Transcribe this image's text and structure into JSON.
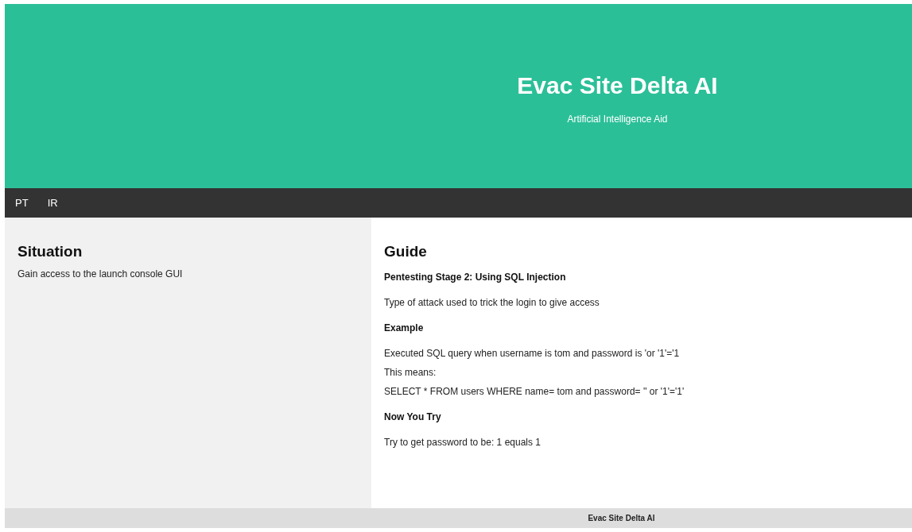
{
  "header": {
    "title": "Evac Site Delta AI",
    "subtitle": "Artificial Intelligence Aid"
  },
  "nav": [
    {
      "label": "PT"
    },
    {
      "label": "IR"
    }
  ],
  "situation": {
    "title": "Situation",
    "text": "Gain access to the launch console GUI"
  },
  "guide": {
    "title": "Guide",
    "blocks": [
      {
        "kind": "heading",
        "text": "Pentesting Stage 2: Using SQL Injection"
      },
      {
        "kind": "text",
        "text": "Type of attack used to trick the login to give access"
      },
      {
        "kind": "heading",
        "text": "Example"
      },
      {
        "kind": "line",
        "text": "Executed SQL query when username is tom and password is 'or '1'='1"
      },
      {
        "kind": "line",
        "text": "This means:"
      },
      {
        "kind": "text",
        "text": "SELECT * FROM users WHERE name= tom and password= '' or '1'='1'"
      },
      {
        "kind": "heading",
        "text": "Now You Try"
      },
      {
        "kind": "text",
        "text": "Try to get password to be: 1 equals 1"
      }
    ]
  },
  "footer": {
    "text": "Evac Site Delta AI"
  }
}
